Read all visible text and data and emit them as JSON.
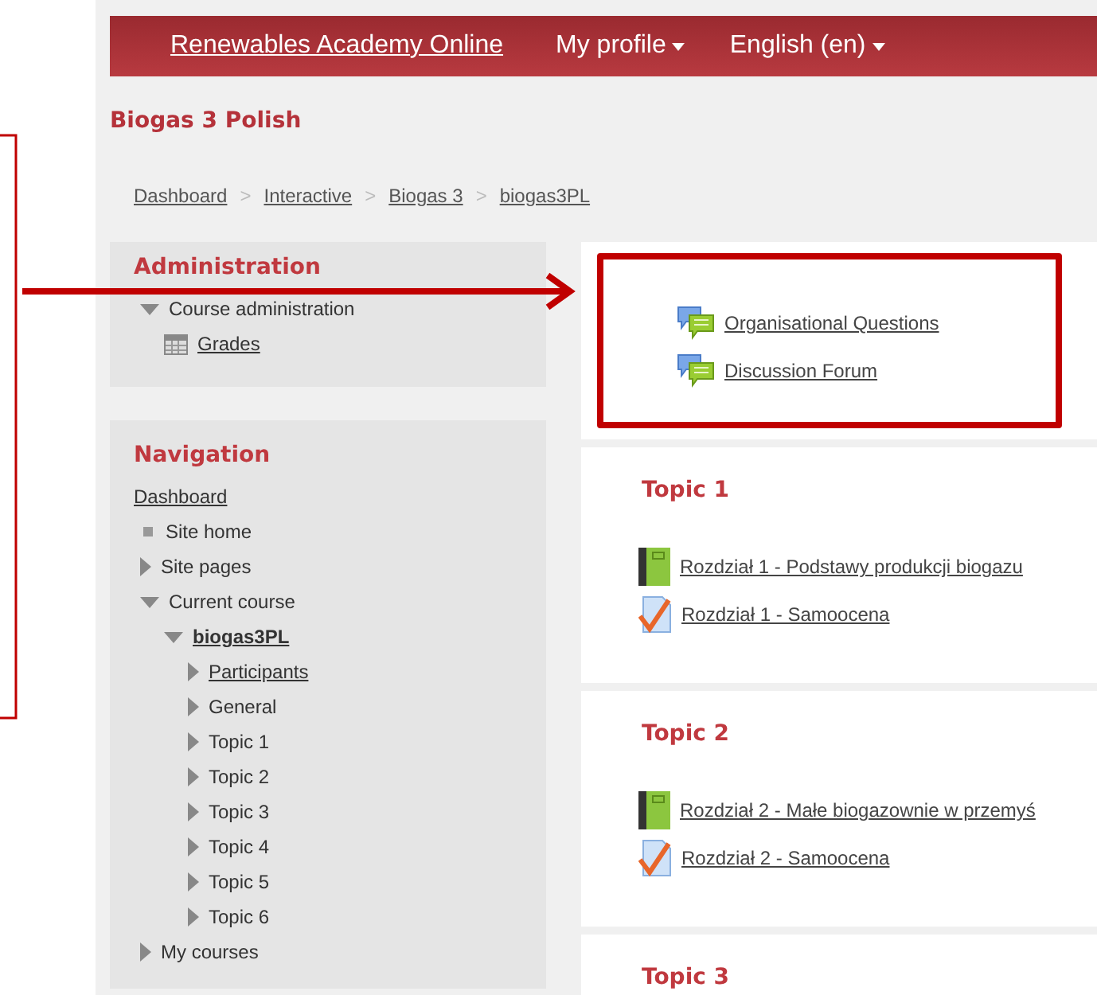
{
  "top_bar": {
    "site_name": "Renewables Academy Online",
    "menus": [
      {
        "label": "My profile"
      },
      {
        "label": "English (en)"
      }
    ]
  },
  "page_title": "Biogas 3 Polish",
  "breadcrumb": [
    "Dashboard",
    "Interactive",
    "Biogas 3",
    "biogas3PL"
  ],
  "breadcrumb_separator": ">",
  "blocks": [
    {
      "title": "Administration",
      "items": [
        {
          "label": "Course administration",
          "kind": "branch",
          "expanded": true,
          "children": [
            {
              "label": "Grades",
              "kind": "grades"
            }
          ]
        }
      ]
    },
    {
      "title": "Navigation",
      "items": [
        {
          "label": "Dashboard",
          "kind": "top_link"
        },
        {
          "label": "Site home",
          "kind": "leaf"
        },
        {
          "label": "Site pages",
          "kind": "branch",
          "expanded": false
        },
        {
          "label": "Current course",
          "kind": "branch",
          "expanded": true,
          "children": [
            {
              "label": "biogas3PL",
              "kind": "course",
              "expanded": true,
              "children": [
                {
                  "label": "Participants",
                  "kind": "branch_link",
                  "expanded": false
                },
                {
                  "label": "General",
                  "kind": "branch",
                  "expanded": false
                },
                {
                  "label": "Topic 1",
                  "kind": "branch",
                  "expanded": false
                },
                {
                  "label": "Topic 2",
                  "kind": "branch",
                  "expanded": false
                },
                {
                  "label": "Topic 3",
                  "kind": "branch",
                  "expanded": false
                },
                {
                  "label": "Topic 4",
                  "kind": "branch",
                  "expanded": false
                },
                {
                  "label": "Topic 5",
                  "kind": "branch",
                  "expanded": false
                },
                {
                  "label": "Topic 6",
                  "kind": "branch",
                  "expanded": false
                }
              ]
            }
          ]
        },
        {
          "label": "My courses",
          "kind": "branch",
          "expanded": false
        }
      ]
    }
  ],
  "sections": [
    {
      "highlighted": true,
      "activities": [
        {
          "label": "Organisational Questions",
          "kind": "forum"
        },
        {
          "label": "Discussion Forum",
          "kind": "forum"
        }
      ]
    },
    {
      "title": "Topic 1",
      "highlighted": false,
      "activities": [
        {
          "label": "Rozdział 1 - Podstawy produkcji biogazu",
          "kind": "book"
        },
        {
          "label": "Rozdział 1 - Samoocena",
          "kind": "quiz"
        }
      ]
    },
    {
      "title": "Topic 2",
      "highlighted": false,
      "activities": [
        {
          "label": "Rozdział 2 - Małe biogazownie w przemyś",
          "kind": "book"
        },
        {
          "label": "Rozdział 2 - Samoocena",
          "kind": "quiz"
        }
      ]
    },
    {
      "title": "Topic 3",
      "highlighted": false
    }
  ]
}
